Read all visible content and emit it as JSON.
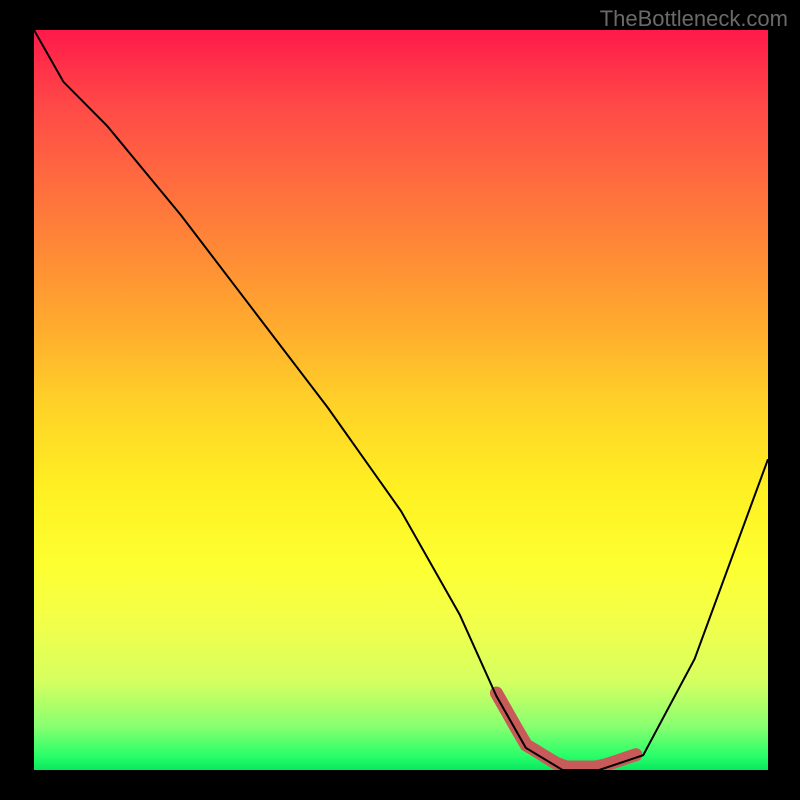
{
  "watermark": "TheBottleneck.com",
  "chart_data": {
    "type": "line",
    "title": "",
    "xlabel": "",
    "ylabel": "",
    "xlim": [
      0,
      100
    ],
    "ylim": [
      0,
      100
    ],
    "grid": false,
    "legend": false,
    "series": [
      {
        "name": "bottleneck-curve",
        "x": [
          0,
          4,
          10,
          20,
          30,
          40,
          50,
          58,
          63,
          67,
          72,
          77,
          83,
          90,
          100
        ],
        "y": [
          100,
          93,
          87,
          75,
          62,
          49,
          35,
          21,
          10,
          3,
          0,
          0,
          2,
          15,
          42
        ]
      }
    ],
    "annotations": [
      {
        "name": "valley-highlight",
        "x_range": [
          63,
          82
        ],
        "y": 0,
        "color": "#c85a5a"
      }
    ],
    "background_gradient": {
      "top": "#ff1a4a",
      "mid": "#fff022",
      "bottom": "#08e85f"
    }
  }
}
